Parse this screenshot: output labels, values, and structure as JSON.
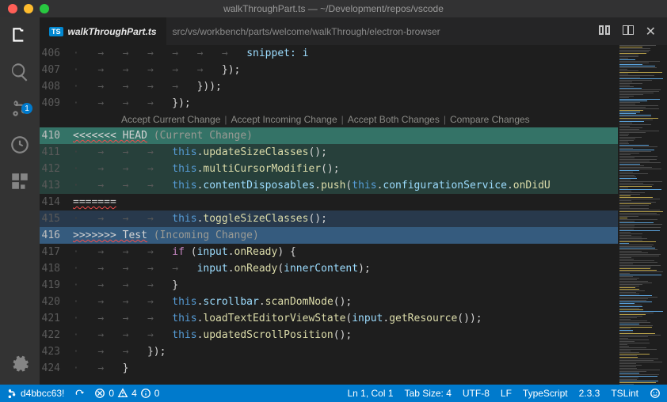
{
  "window": {
    "title": "walkThroughPart.ts — ~/Development/repos/vscode"
  },
  "tab": {
    "lang_badge": "TS",
    "filename": "walkThroughPart.ts"
  },
  "breadcrumb": "src/vs/workbench/parts/welcome/walkThrough/electron-browser",
  "scm_badge": "1",
  "codelens": {
    "accept_current": "Accept Current Change",
    "accept_incoming": "Accept Incoming Change",
    "accept_both": "Accept Both Changes",
    "compare": "Compare Changes"
  },
  "conflict": {
    "head_marker": "<<<<<<< HEAD",
    "head_label": "(Current Change)",
    "sep": "=======",
    "incoming_marker": ">>>>>>> Test",
    "incoming_label": "(Incoming Change)"
  },
  "lines": {
    "l406": "406",
    "l407": "407",
    "l408": "408",
    "l409": "409",
    "l410": "410",
    "l411": "411",
    "l412": "412",
    "l413": "413",
    "l414": "414",
    "l415": "415",
    "l416": "416",
    "l417": "417",
    "l418": "418",
    "l419": "419",
    "l420": "420",
    "l421": "421",
    "l422": "422",
    "l423": "423",
    "l424": "424"
  },
  "code": {
    "snippet": "snippet:",
    "i": "i",
    "close_paren_brace_semi": "});",
    "close_brace_paren_brace_semi": "}));",
    "close_brace": "}",
    "this": "this",
    "dot": ".",
    "updateSizeClasses": "updateSizeClasses",
    "multiCursorModifier": "multiCursorModifier",
    "contentDisposables": "contentDisposables",
    "push": "push",
    "configurationService": "configurationService",
    "onDidU": "onDidU",
    "toggleSizeClasses": "toggleSizeClasses",
    "if": "if",
    "input": "input",
    "onReady": "onReady",
    "open_brace": "{",
    "innerContent": "innerContent",
    "scrollbar": "scrollbar",
    "scanDomNode": "scanDomNode",
    "loadTextEditorViewState": "loadTextEditorViewState",
    "getResource": "getResource",
    "updatedScrollPosition": "updatedScrollPosition",
    "paren_empty": "()",
    "paren_open": "(",
    "paren_close": ")",
    "semi": ";"
  },
  "statusbar": {
    "branch": "d4bbcc63!",
    "errors": "0",
    "warnings": "4",
    "info": "0",
    "cursor": "Ln 1, Col 1",
    "indent": "Tab Size: 4",
    "encoding": "UTF-8",
    "eol": "LF",
    "language": "TypeScript",
    "tsver": "2.3.3",
    "lint": "TSLint"
  }
}
